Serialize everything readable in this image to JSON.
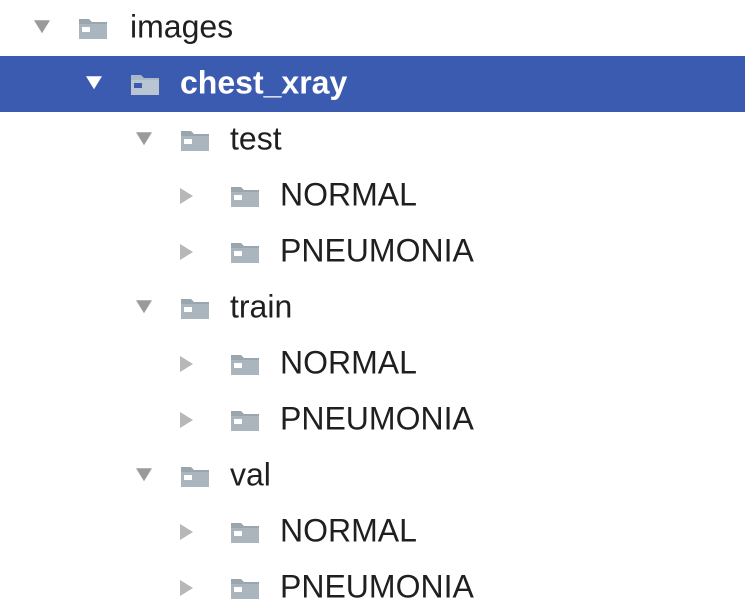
{
  "colors": {
    "selection_background": "#3b5bb0",
    "folder_gray": "#9aa6ae",
    "folder_on_selection": "#a9b9c6",
    "arrow_gray": "#9a9a9a",
    "text": "#1f1f1f"
  },
  "tree": {
    "root": {
      "label": "images",
      "expanded": true,
      "icon": "folder-icon",
      "children": [
        {
          "label": "chest_xray",
          "expanded": true,
          "selected": true,
          "icon": "folder-icon",
          "children": [
            {
              "label": "test",
              "expanded": true,
              "icon": "folder-icon",
              "children": [
                {
                  "label": "NORMAL",
                  "expanded": false,
                  "icon": "folder-icon"
                },
                {
                  "label": "PNEUMONIA",
                  "expanded": false,
                  "icon": "folder-icon"
                }
              ]
            },
            {
              "label": "train",
              "expanded": true,
              "icon": "folder-icon",
              "children": [
                {
                  "label": "NORMAL",
                  "expanded": false,
                  "icon": "folder-icon"
                },
                {
                  "label": "PNEUMONIA",
                  "expanded": false,
                  "icon": "folder-icon"
                }
              ]
            },
            {
              "label": "val",
              "expanded": true,
              "icon": "folder-icon",
              "children": [
                {
                  "label": "NORMAL",
                  "expanded": false,
                  "icon": "folder-icon"
                },
                {
                  "label": "PNEUMONIA",
                  "expanded": false,
                  "icon": "folder-icon"
                }
              ]
            }
          ]
        }
      ]
    }
  }
}
